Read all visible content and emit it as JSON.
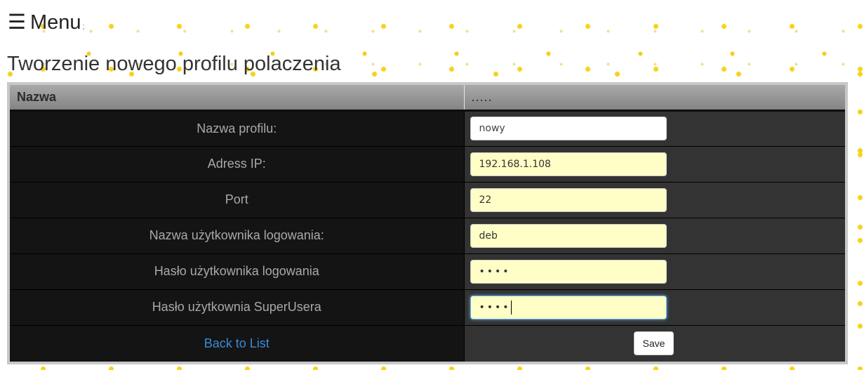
{
  "menu": {
    "icon": "hamburger-icon",
    "label": "Menu",
    "separator": ";"
  },
  "page": {
    "title": "Tworzenie nowego profilu polaczenia"
  },
  "table": {
    "headers": [
      "Nazwa",
      "....."
    ],
    "rows": [
      {
        "label": "Nazwa profilu:",
        "value": "nowy"
      },
      {
        "label": "Adress IP:",
        "value": "192.168.1.108"
      },
      {
        "label": "Port",
        "value": "22"
      },
      {
        "label": "Nazwa użytkownika logowania:",
        "value": "deb"
      },
      {
        "label": "Hasło użytkownika logowania",
        "value": "••••"
      },
      {
        "label": "Hasło użytkownia SuperUsera",
        "value": "••••"
      }
    ]
  },
  "actions": {
    "back_label": "Back to List",
    "save_label": "Save"
  },
  "colors": {
    "label_bg": "#141414",
    "value_bg": "#333333",
    "autofill_bg": "#fffec6",
    "link": "#3a8bd6",
    "dot": "#f7d31a"
  }
}
